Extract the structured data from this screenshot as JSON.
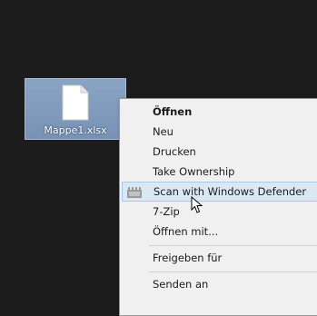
{
  "desktop": {
    "file_name": "Mappe1.xlsx"
  },
  "context_menu": {
    "items": [
      {
        "label": "Öffnen",
        "bold": true
      },
      {
        "label": "Neu"
      },
      {
        "label": "Drucken"
      },
      {
        "label": "Take Ownership"
      },
      {
        "label": "Scan with Windows Defender",
        "highlighted": true,
        "icon": "windows-defender-icon"
      },
      {
        "label": "7-Zip"
      },
      {
        "label": "Öffnen mit..."
      },
      {
        "label": "Freigeben für"
      },
      {
        "label": "Senden an"
      }
    ]
  },
  "colors": {
    "desktop_background": "#1c1c1c",
    "selection": "#8ba4c4",
    "menu_background": "#f0f0f0",
    "highlight": "#dae8f6"
  }
}
